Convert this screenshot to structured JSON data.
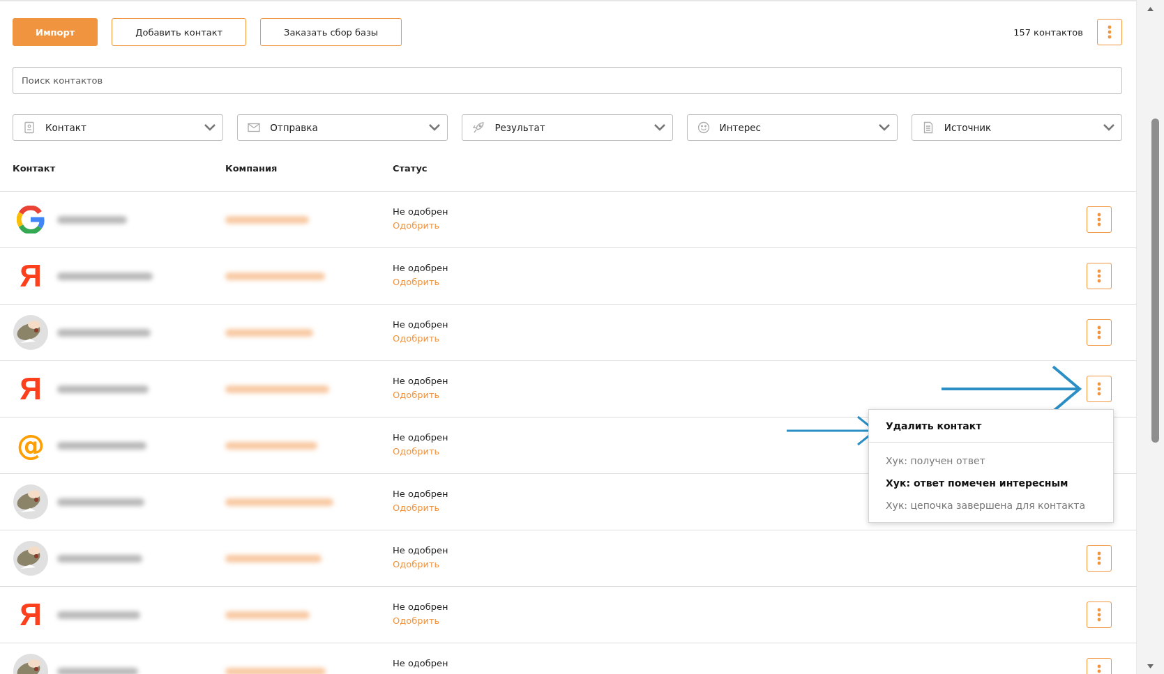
{
  "toolbar": {
    "buttons": [
      {
        "label": "Импорт",
        "kind": "primary"
      },
      {
        "label": "Добавить контакт",
        "kind": "outline"
      },
      {
        "label": "Заказать сбор базы",
        "kind": "outline"
      }
    ],
    "count": "157 контактов"
  },
  "search": {
    "placeholder": "Поиск контактов"
  },
  "filters": [
    {
      "label": "Контакт"
    },
    {
      "label": "Отправка"
    },
    {
      "label": "Результат"
    },
    {
      "label": "Интерес"
    },
    {
      "label": "Источник"
    }
  ],
  "table": {
    "columns": [
      "Контакт",
      "Компания",
      "Статус"
    ],
    "rows": [
      {
        "avatar": {
          "kind": "google"
        },
        "status": "Не одобрен",
        "action": "Одобрить",
        "menu_button": true
      },
      {
        "avatar": {
          "kind": "letter",
          "text": "Я"
        },
        "status": "Не одобрен",
        "action": "Одобрить",
        "menu_button": true
      },
      {
        "status": "Не одобрен",
        "action": "Одобрить",
        "menu_button": true
      },
      {
        "avatar": {
          "kind": "letter",
          "text": "Я"
        },
        "status": "Не одобрен",
        "action": "Одобрить",
        "menu_button": true
      },
      {
        "avatar": {
          "kind": "at",
          "text": "@"
        },
        "status": "Не одобрен",
        "action": "Одобрить",
        "menu_button": false
      },
      {
        "status": "Не одобрен",
        "action": "Одобрить",
        "menu_button": false
      },
      {
        "status": "Не одобрен",
        "action": "Одобрить",
        "menu_button": true
      },
      {
        "avatar": {
          "kind": "letter",
          "text": "Я"
        },
        "status": "Не одобрен",
        "action": "Одобрить",
        "menu_button": true
      },
      {
        "status": "Не одобрен",
        "menu_button": true
      }
    ]
  },
  "context_menu": {
    "items": [
      {
        "label": "Удалить контакт",
        "disabled": false,
        "divider_after": true
      },
      {
        "label": "Хук: получен ответ",
        "disabled": true,
        "divider_after": false
      },
      {
        "label": "Хук: ответ помечен интересным",
        "disabled": false,
        "divider_after": false
      },
      {
        "label": "Хук: цепочка завершена для контакта",
        "disabled": true,
        "divider_after": false
      }
    ]
  }
}
